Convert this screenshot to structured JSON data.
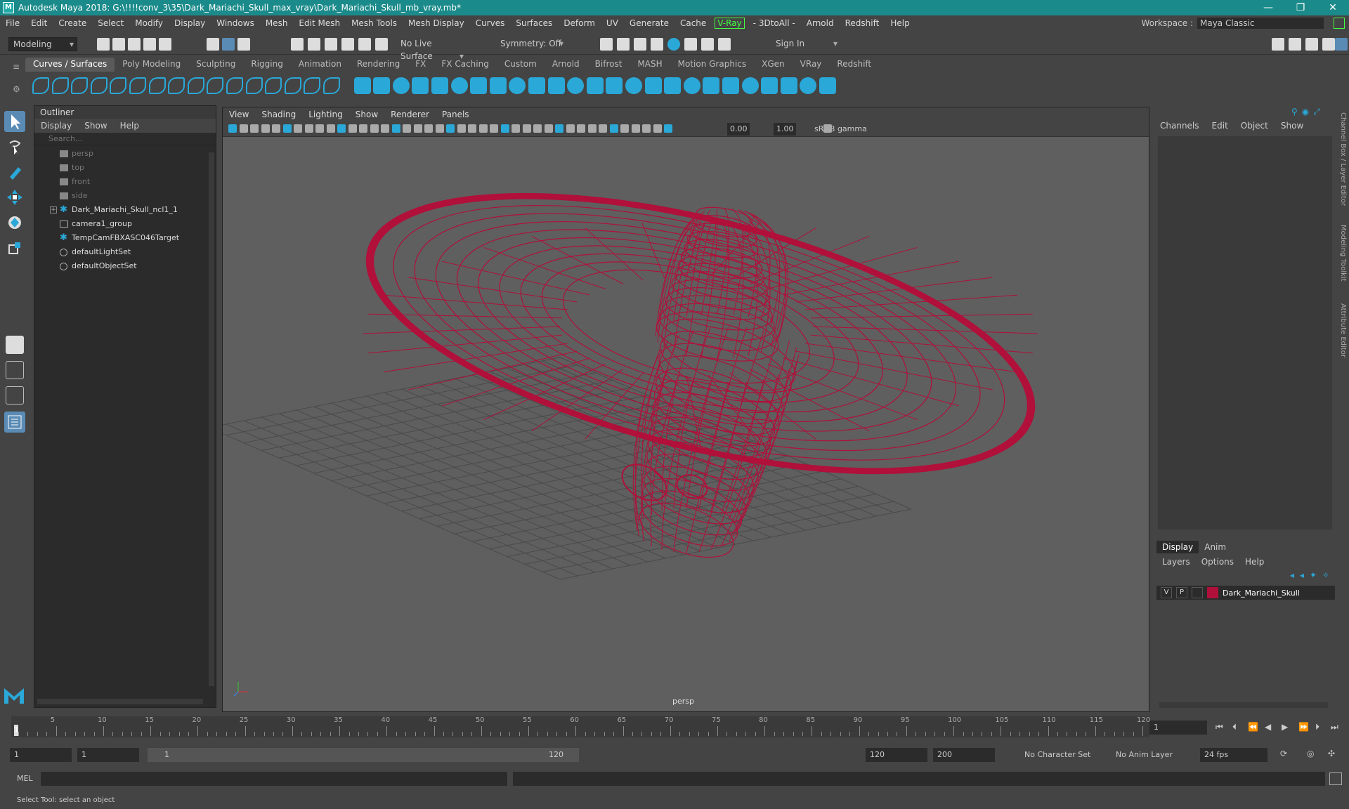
{
  "window": {
    "title": "Autodesk Maya 2018: G:\\!!!!conv_3\\35\\Dark_Mariachi_Skull_max_vray\\Dark_Mariachi_Skull_mb_vray.mb*",
    "logo": "M",
    "minimize": "—",
    "restore": "❐",
    "close": "✕"
  },
  "menubar": {
    "items": [
      "File",
      "Edit",
      "Create",
      "Select",
      "Modify",
      "Display",
      "Windows",
      "Mesh",
      "Edit Mesh",
      "Mesh Tools",
      "Mesh Display",
      "Curves",
      "Surfaces",
      "Deform",
      "UV",
      "Generate",
      "Cache"
    ],
    "vray": "V-Ray",
    "items2": [
      "- 3DtoAll -",
      "Arnold",
      "Redshift",
      "Help"
    ],
    "workspace_label": "Workspace :",
    "workspace_value": "Maya Classic"
  },
  "statusline": {
    "mode": "Modeling",
    "live_surface": "No Live Surface",
    "symmetry": "Symmetry: Off",
    "sign_in": "Sign In"
  },
  "shelf": {
    "tabs": [
      "Curves / Surfaces",
      "Poly Modeling",
      "Sculpting",
      "Rigging",
      "Animation",
      "Rendering",
      "FX",
      "FX Caching",
      "Custom",
      "Arnold",
      "Bifrost",
      "MASH",
      "Motion Graphics",
      "XGen",
      "VRay",
      "Redshift"
    ],
    "active_tab": 0
  },
  "outliner": {
    "title": "Outliner",
    "menu": [
      "Display",
      "Show",
      "Help"
    ],
    "search_placeholder": "Search...",
    "items": [
      {
        "label": "persp",
        "dim": true,
        "icon": "camera-icon"
      },
      {
        "label": "top",
        "dim": true,
        "icon": "camera-icon"
      },
      {
        "label": "front",
        "dim": true,
        "icon": "camera-icon"
      },
      {
        "label": "side",
        "dim": true,
        "icon": "camera-icon"
      },
      {
        "label": "Dark_Mariachi_Skull_ncl1_1",
        "dim": false,
        "icon": "group-icon",
        "expandable": true
      },
      {
        "label": "camera1_group",
        "dim": false,
        "icon": "transform-icon"
      },
      {
        "label": "TempCamFBXASC046Target",
        "dim": false,
        "icon": "group-icon"
      },
      {
        "label": "defaultLightSet",
        "dim": false,
        "icon": "set-icon"
      },
      {
        "label": "defaultObjectSet",
        "dim": false,
        "icon": "set-icon"
      }
    ]
  },
  "viewport": {
    "menu": [
      "View",
      "Shading",
      "Lighting",
      "Show",
      "Renderer",
      "Panels"
    ],
    "exposure": "0.00",
    "gamma": "1.00",
    "color_space": "sRGB gamma",
    "camera_label": "persp",
    "wire_color": "#b0103a"
  },
  "channelbox": {
    "menu": [
      "Channels",
      "Edit",
      "Object",
      "Show"
    ]
  },
  "layereditor": {
    "tabs": [
      "Display",
      "Anim"
    ],
    "menu": [
      "Layers",
      "Options",
      "Help"
    ],
    "layer": {
      "v": "V",
      "p": "P",
      "name": "Dark_Mariachi_Skull",
      "color": "#b0103a"
    }
  },
  "sidetabs": [
    "Channel Box / Layer Editor",
    "Modeling Toolkit",
    "Attribute Editor"
  ],
  "timeline": {
    "ticks": [
      "5",
      "10",
      "15",
      "20",
      "25",
      "30",
      "35",
      "40",
      "45",
      "50",
      "55",
      "60",
      "65",
      "70",
      "75",
      "80",
      "85",
      "90",
      "95",
      "100",
      "105",
      "110",
      "115",
      "120"
    ],
    "current_frame": "1",
    "start_marker": "1"
  },
  "range": {
    "start": "1",
    "playback_start": "1",
    "slider_start": "1",
    "slider_end": "120",
    "playback_end": "120",
    "end": "200",
    "character_set": "No Character Set",
    "anim_layer": "No Anim Layer",
    "fps": "24 fps"
  },
  "cmdline": {
    "label": "MEL"
  },
  "helpline": {
    "text": "Select Tool: select an object"
  }
}
